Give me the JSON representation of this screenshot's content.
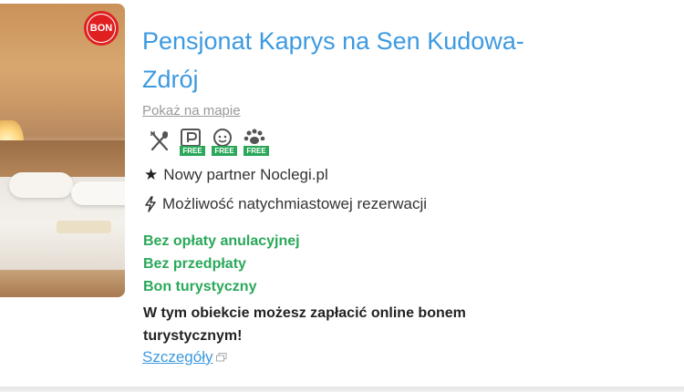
{
  "listing": {
    "title": "Pensjonat Kaprys na Sen Kudowa-Zdrój",
    "map_link": "Pokaż na mapie",
    "badge": "BON",
    "amenities": [
      {
        "icon": "restaurant-icon",
        "free_label": ""
      },
      {
        "icon": "parking-icon",
        "free_label": "FREE"
      },
      {
        "icon": "kids-icon",
        "free_label": "FREE"
      },
      {
        "icon": "pets-icon",
        "free_label": "FREE"
      }
    ],
    "partner_text": "Nowy partner Noclegi.pl",
    "instant_text": "Możliwość natychmiastowej rezerwacji",
    "no_cancel_fee": "Bez opłaty anulacyjnej",
    "no_prepayment": "Bez przedpłaty",
    "tourist_voucher": "Bon turystyczny",
    "voucher_info": "W tym obiekcie możesz zapłacić online bonem turystycznym!",
    "details_link": "Szczegóły"
  },
  "colors": {
    "title": "#3d9ae0",
    "green": "#2aa85a",
    "badge": "#e02020",
    "link_muted": "#9a9a9a"
  }
}
